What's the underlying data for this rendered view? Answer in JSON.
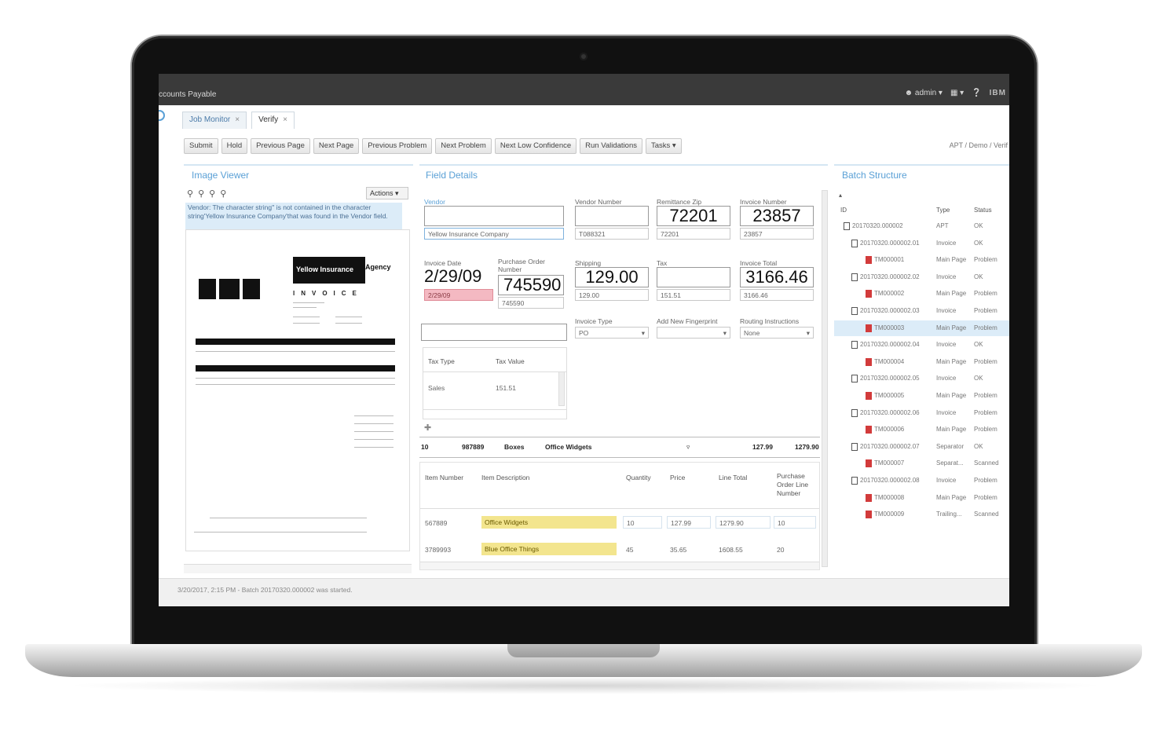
{
  "window": {
    "app_title": "ccounts Payable",
    "user": "admin",
    "brand": "IBM",
    "breadcrumb": "APT / Demo / Verif"
  },
  "tabs": [
    {
      "label": "Job Monitor"
    },
    {
      "label": "Verify"
    }
  ],
  "toolbar": {
    "buttons": [
      "Submit",
      "Hold",
      "Previous Page",
      "Next Page",
      "Previous Problem",
      "Next Problem",
      "Next Low Confidence",
      "Run Validations",
      "Tasks"
    ]
  },
  "image_viewer": {
    "title": "Image Viewer",
    "actions_label": "Actions",
    "warning": "Vendor: The character string'' is not contained in the character string'Yellow Insurance Company'that was found in the Vendor field.",
    "doc_company": "Yellow Insurance",
    "doc_company2": "Agency",
    "doc_invoice": "INVOICE"
  },
  "field_details": {
    "title": "Field Details",
    "vendor": {
      "label": "Vendor",
      "value": "Yellow Insurance Company"
    },
    "vendor_number": {
      "label": "Vendor Number",
      "value": "T088321"
    },
    "remittance_zip": {
      "label": "Remittance Zip",
      "big": "72201",
      "value": "72201"
    },
    "invoice_number": {
      "label": "Invoice Number",
      "big": "23857",
      "value": "23857"
    },
    "invoice_date": {
      "label": "Invoice Date",
      "big": "2/29/09",
      "value": "2/29/09"
    },
    "po_number": {
      "label": "Purchase Order Number",
      "big": "745590",
      "value": "745590"
    },
    "shipping": {
      "label": "Shipping",
      "big": "129.00",
      "value": "129.00"
    },
    "tax": {
      "label": "Tax",
      "big": "",
      "value": "151.51"
    },
    "invoice_total": {
      "label": "Invoice Total",
      "big": "3166.46",
      "value": "3166.46"
    },
    "invoice_type": {
      "label": "Invoice Type",
      "value": "PO"
    },
    "fingerprint": {
      "label": "Add New Fingerprint",
      "value": ""
    },
    "routing": {
      "label": "Routing Instructions",
      "value": "None"
    },
    "tax_table": {
      "headers": [
        "Tax Type",
        "Tax Value"
      ],
      "rows": [
        [
          "Sales",
          "151.51"
        ]
      ]
    },
    "line_preview": [
      "10",
      "987889",
      "Boxes",
      "Office Widgets",
      "127.99",
      "1279.90"
    ],
    "line_items": {
      "headers": [
        "Item Number",
        "Item Description",
        "Quantity",
        "Price",
        "Line Total",
        "Purchase Order Line Number"
      ],
      "rows": [
        [
          "567889",
          "Office Widgets",
          "10",
          "127.99",
          "1279.90",
          "10"
        ],
        [
          "3789993",
          "Blue Office Things",
          "45",
          "35.65",
          "1608.55",
          "20"
        ]
      ]
    }
  },
  "batch_structure": {
    "title": "Batch Structure",
    "headers": [
      "ID",
      "Type",
      "Status"
    ],
    "rows": [
      {
        "id": "20170320.000002",
        "type": "APT",
        "status": "OK",
        "kind": "batch"
      },
      {
        "id": "20170320.000002.01",
        "type": "Invoice",
        "status": "OK",
        "kind": "doc"
      },
      {
        "id": "TM000001",
        "type": "Main Page",
        "status": "Problem",
        "kind": "page"
      },
      {
        "id": "20170320.000002.02",
        "type": "Invoice",
        "status": "OK",
        "kind": "doc"
      },
      {
        "id": "TM000002",
        "type": "Main Page",
        "status": "Problem",
        "kind": "page"
      },
      {
        "id": "20170320.000002.03",
        "type": "Invoice",
        "status": "Problem",
        "kind": "doc"
      },
      {
        "id": "TM000003",
        "type": "Main Page",
        "status": "Problem",
        "kind": "page",
        "selected": true
      },
      {
        "id": "20170320.000002.04",
        "type": "Invoice",
        "status": "OK",
        "kind": "doc"
      },
      {
        "id": "TM000004",
        "type": "Main Page",
        "status": "Problem",
        "kind": "page"
      },
      {
        "id": "20170320.000002.05",
        "type": "Invoice",
        "status": "OK",
        "kind": "doc"
      },
      {
        "id": "TM000005",
        "type": "Main Page",
        "status": "Problem",
        "kind": "page"
      },
      {
        "id": "20170320.000002.06",
        "type": "Invoice",
        "status": "Problem",
        "kind": "doc"
      },
      {
        "id": "TM000006",
        "type": "Main Page",
        "status": "Problem",
        "kind": "page"
      },
      {
        "id": "20170320.000002.07",
        "type": "Separator",
        "status": "OK",
        "kind": "doc"
      },
      {
        "id": "TM000007",
        "type": "Separat...",
        "status": "Scanned",
        "kind": "page"
      },
      {
        "id": "20170320.000002.08",
        "type": "Invoice",
        "status": "Problem",
        "kind": "doc"
      },
      {
        "id": "TM000008",
        "type": "Main Page",
        "status": "Problem",
        "kind": "page"
      },
      {
        "id": "TM000009",
        "type": "Trailing...",
        "status": "Scanned",
        "kind": "page"
      }
    ]
  },
  "status_bar": "3/20/2017, 2:15 PM - Batch 20170320.000002 was started."
}
